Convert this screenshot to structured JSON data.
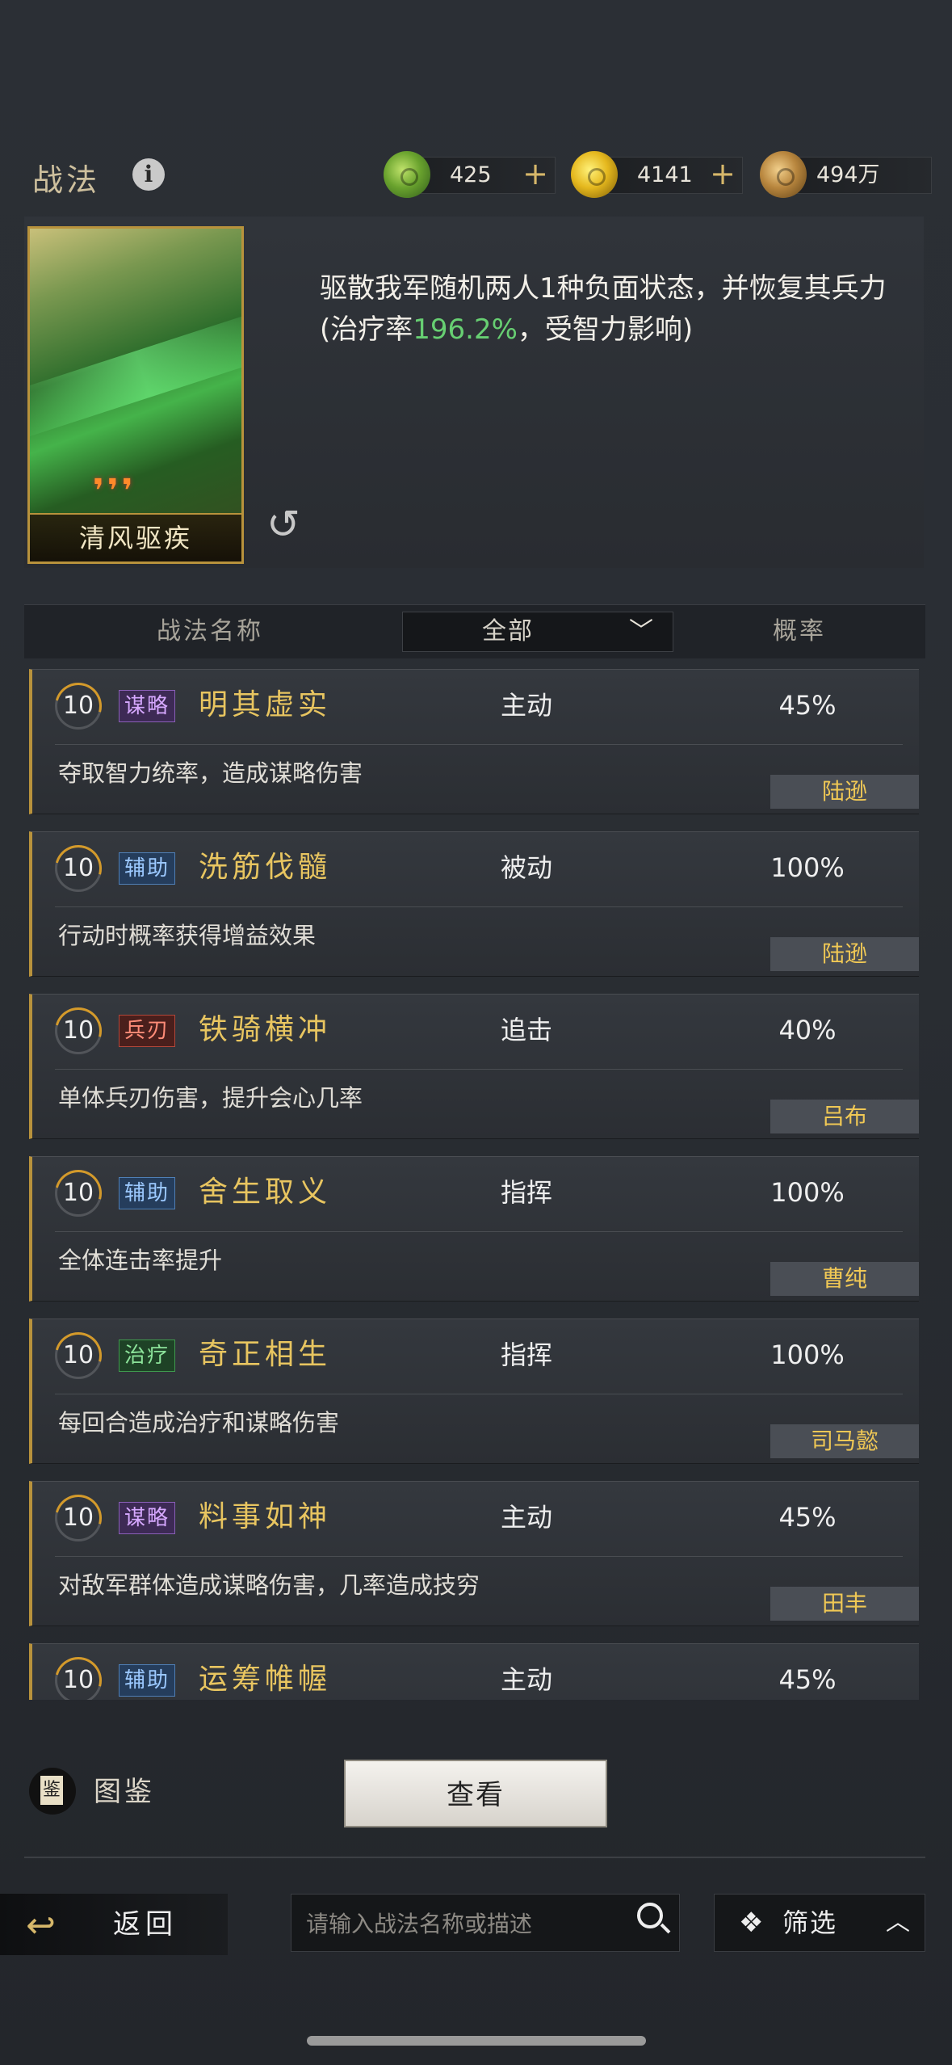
{
  "header": {
    "title": "战法",
    "resources": [
      {
        "icon": "jade-coin-icon",
        "value": "425",
        "plus": "+"
      },
      {
        "icon": "gold-coin-icon",
        "value": "4141",
        "plus": "+"
      },
      {
        "icon": "copper-coin-icon",
        "value": "494万"
      }
    ]
  },
  "selected": {
    "card_name": "清风驱疾",
    "desc_before": "驱散我军随机两人1种负面状态，并恢复其兵力(治疗率",
    "desc_highlight": "196.2%",
    "desc_after": "，受智力影响)"
  },
  "table_head": {
    "name_col": "战法名称",
    "filter_value": "全部",
    "rate_col": "概率"
  },
  "skills": [
    {
      "level": "10",
      "tag": "谋略",
      "name": "明其虚实",
      "type": "主动",
      "rate": "45%",
      "desc": "夺取智力统率，造成谋略伤害",
      "hero": "陆逊"
    },
    {
      "level": "10",
      "tag": "辅助",
      "name": "洗筋伐髓",
      "type": "被动",
      "rate": "100%",
      "desc": "行动时概率获得增益效果",
      "hero": "陆逊"
    },
    {
      "level": "10",
      "tag": "兵刃",
      "name": "铁骑横冲",
      "type": "追击",
      "rate": "40%",
      "desc": "单体兵刃伤害，提升会心几率",
      "hero": "吕布"
    },
    {
      "level": "10",
      "tag": "辅助",
      "name": "舍生取义",
      "type": "指挥",
      "rate": "100%",
      "desc": "全体连击率提升",
      "hero": "曹纯"
    },
    {
      "level": "10",
      "tag": "治疗",
      "name": "奇正相生",
      "type": "指挥",
      "rate": "100%",
      "desc": "每回合造成治疗和谋略伤害",
      "hero": "司马懿"
    },
    {
      "level": "10",
      "tag": "谋略",
      "name": "料事如神",
      "type": "主动",
      "rate": "45%",
      "desc": "对敌军群体造成谋略伤害，几率造成技穷",
      "hero": "田丰"
    },
    {
      "level": "10",
      "tag": "辅助",
      "name": "运筹帷幄",
      "type": "主动",
      "rate": "45%",
      "desc": "",
      "hero": ""
    }
  ],
  "bottom": {
    "atlas_glyph": "鉴",
    "atlas_label": "图鉴",
    "view_button": "查看",
    "back_label": "返回",
    "search_placeholder": "请输入战法名称或描述",
    "filter_label": "筛选"
  }
}
